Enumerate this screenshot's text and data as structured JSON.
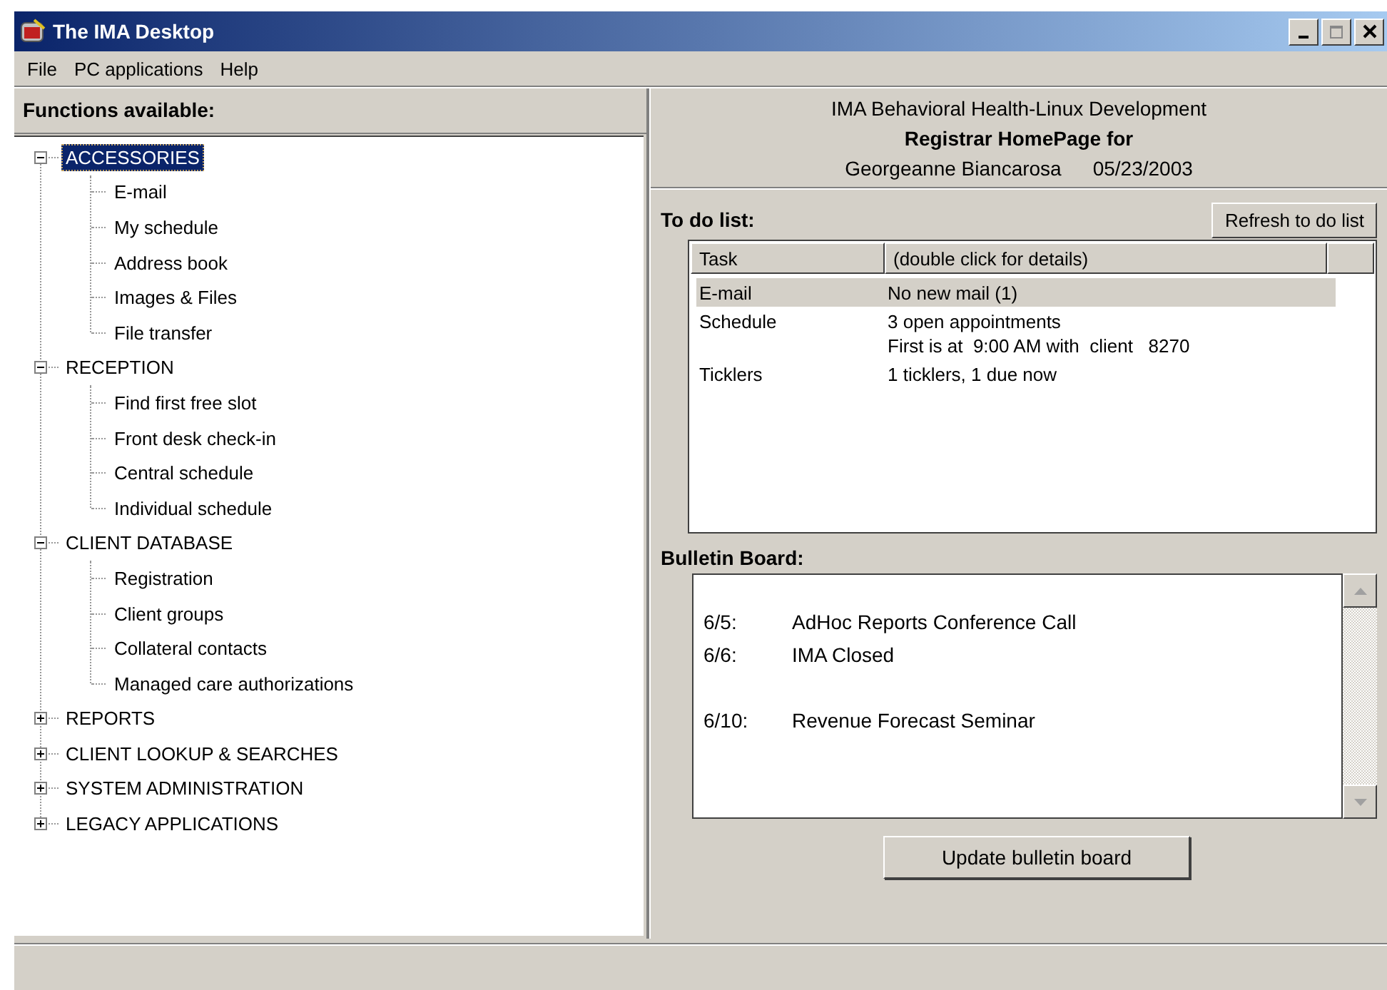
{
  "window": {
    "title": "The IMA Desktop"
  },
  "menu": [
    "File",
    "PC applications",
    "Help"
  ],
  "functions": {
    "title": "Functions available:",
    "tree": [
      {
        "label": "ACCESSORIES",
        "expanded": true,
        "selected": true,
        "children": [
          {
            "label": "E-mail",
            "selected": false
          },
          {
            "label": "My schedule",
            "selected": false
          },
          {
            "label": "Address book",
            "selected": false
          },
          {
            "label": "Images & Files",
            "selected": false
          },
          {
            "label": "File transfer",
            "selected": false
          }
        ]
      },
      {
        "label": "RECEPTION",
        "expanded": true,
        "selected": false,
        "children": [
          {
            "label": "Find first free slot",
            "selected": false
          },
          {
            "label": "Front desk check-in",
            "selected": false
          },
          {
            "label": "Central schedule",
            "selected": false
          },
          {
            "label": "Individual schedule",
            "selected": false
          }
        ]
      },
      {
        "label": "CLIENT DATABASE",
        "expanded": true,
        "selected": false,
        "children": [
          {
            "label": "Registration",
            "selected": false
          },
          {
            "label": "Client groups",
            "selected": false
          },
          {
            "label": "Collateral contacts",
            "selected": false
          },
          {
            "label": "Managed care authorizations",
            "selected": false
          }
        ]
      },
      {
        "label": "REPORTS",
        "expanded": false,
        "selected": false
      },
      {
        "label": "CLIENT LOOKUP & SEARCHES",
        "expanded": false,
        "selected": false
      },
      {
        "label": "SYSTEM ADMINISTRATION",
        "expanded": false,
        "selected": false
      },
      {
        "label": "LEGACY APPLICATIONS",
        "expanded": false,
        "selected": false
      }
    ]
  },
  "home": {
    "organization": "IMA Behavioral Health-Linux Development",
    "heading": "Registrar HomePage for",
    "user": "Georgeanne Biancarosa",
    "date": "05/23/2003"
  },
  "todo": {
    "title": "To do list:",
    "refresh_button": "Refresh to do list",
    "columns": [
      "Task",
      "(double click for details)"
    ],
    "rows": [
      {
        "task": "E-mail",
        "details": [
          "No new mail (1)"
        ],
        "selected": true
      },
      {
        "task": "Schedule",
        "details": [
          "3 open appointments",
          "First is at  9:00 AM with  client   8270"
        ],
        "selected": false
      },
      {
        "task": "Ticklers",
        "details": [
          "1 ticklers, 1 due now"
        ],
        "selected": false
      }
    ]
  },
  "bulletin": {
    "title": "Bulletin Board:",
    "update_button": "Update bulletin board",
    "groups": [
      [
        {
          "date": "6/5:",
          "text": "AdHoc Reports Conference Call"
        },
        {
          "date": "6/6:",
          "text": "IMA Closed"
        }
      ],
      [
        {
          "date": "6/10:",
          "text": "Revenue Forecast Seminar"
        }
      ]
    ]
  }
}
